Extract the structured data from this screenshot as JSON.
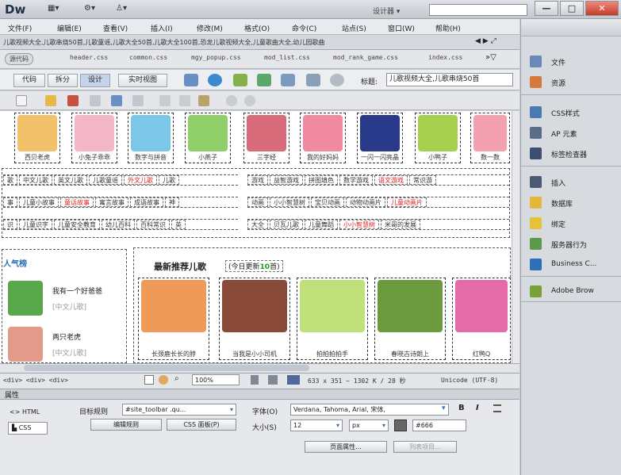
{
  "app": {
    "logo": "Dw",
    "workspace": "设计器",
    "window_buttons": [
      "—",
      "□",
      "✕"
    ]
  },
  "menus": [
    "文件(F)",
    "编辑(E)",
    "查看(V)",
    "插入(I)",
    "修改(M)",
    "格式(O)",
    "命令(C)",
    "站点(S)",
    "窗口(W)",
    "帮助(H)"
  ],
  "doc_tab": "儿歌视频大全,儿歌串烧50首,儿歌童谣,儿歌大全50首,儿歌大全100首,恐龙儿歌视频大全,儿童歌曲大全,幼儿园歌曲",
  "related_files": [
    "源代码",
    "header.css",
    "common.css",
    "mgy_popup.css",
    "mod_list.css",
    "mod_rank_game.css",
    "index.css"
  ],
  "view_buttons": [
    "代码",
    "拆分",
    "设计",
    "实时视图"
  ],
  "title_label": "标题:",
  "title_value": "儿歌视频大全,儿歌串烧50首",
  "top_captions": [
    "西贝老虎",
    "小兔子乖乖",
    "数字与拼音",
    "小燕子",
    "三字经",
    "我的好妈妈",
    "一闪一闪亮晶",
    "小鸭子",
    "数一数"
  ],
  "nav_rows": [
    {
      "left": [
        "歌",
        "中文儿歌",
        "英文儿歌",
        "儿歌童谣",
        "外文儿歌",
        "儿歌"
      ],
      "right": [
        "游戏",
        "益智游戏",
        "拼图填色",
        "数学游戏",
        "语文游戏",
        "常识游"
      ],
      "left_red": [
        4
      ],
      "right_red": [
        4
      ]
    },
    {
      "left": [
        "事",
        "儿童小故事",
        "童话故事",
        "寓言故事",
        "成语故事",
        "神"
      ],
      "right": [
        "动画",
        "小小智慧树",
        "宝贝动画",
        "动物动画片",
        "儿童动画片"
      ],
      "left_red": [
        2
      ],
      "right_red": [
        4
      ]
    },
    {
      "left": [
        "识",
        "儿童识字",
        "儿童安全教育",
        "幼儿百科",
        "百科常识",
        "英"
      ],
      "right": [
        "大全",
        "贝瓦儿歌",
        "儿童舞蹈",
        "小小智慧树",
        "米哥的发展"
      ],
      "left_red": [],
      "right_red": [
        3
      ]
    }
  ],
  "popular_title": "人气榜",
  "popular": [
    {
      "name": "我有一个好爸爸",
      "tag": "[中文儿歌]"
    },
    {
      "name": "两只老虎",
      "tag": "[中文儿歌]"
    }
  ],
  "recommend_title": "最新推荐儿歌",
  "recommend_note": "今日更新",
  "recommend_count": "10",
  "recommend_unit": "首",
  "recommend_captions": [
    "长颈鹿长长的脖",
    "当我是小小司机",
    "拍拍拍拍手",
    "春晓古诗朗上",
    "红鸭Q"
  ],
  "status": {
    "path": "<div> <div> <div>",
    "zoom": "100%",
    "dims": "633 x 351 ~ 1302 K / 28 秒",
    "encoding": "Unicode (UTF-8)"
  },
  "properties": {
    "header": "属性",
    "html_label": "HTML",
    "css_label": "CSS",
    "target_rule_label": "目标规则",
    "target_rule_value": "#site_toolbar .qu...",
    "edit_rule_btn": "编辑规则",
    "css_panel_btn": "CSS 面板(P)",
    "font_label": "字体(O)",
    "font_value": "Verdana, Tahoma, Arial, 宋体,",
    "bold": "B",
    "italic": "I",
    "size_label": "大小(S)",
    "size_value": "12",
    "unit_value": "px",
    "color_value": "#666",
    "page_props_btn": "页面属性...",
    "list_item_btn": "列表项目..."
  },
  "panel": {
    "group1": [
      {
        "label": "文件",
        "icon": "files-icon"
      },
      {
        "label": "资源",
        "icon": "assets-icon"
      }
    ],
    "group2": [
      {
        "label": "CSS样式",
        "icon": "css-styles-icon"
      },
      {
        "label": "AP 元素",
        "icon": "ap-elements-icon"
      },
      {
        "label": "标签检查器",
        "icon": "tag-inspector-icon"
      }
    ],
    "group3": [
      {
        "label": "插入",
        "icon": "insert-icon"
      },
      {
        "label": "数据库",
        "icon": "database-icon"
      },
      {
        "label": "绑定",
        "icon": "bindings-icon"
      },
      {
        "label": "服务器行为",
        "icon": "server-behaviors-icon"
      },
      {
        "label": "Business C...",
        "icon": "business-catalyst-icon"
      }
    ],
    "group4": [
      {
        "label": "Adobe Brow",
        "icon": "browserlab-icon"
      }
    ]
  },
  "colors": {
    "accent": "#2f6fb5",
    "red_link": "#e02020",
    "green_count": "#18a018"
  }
}
